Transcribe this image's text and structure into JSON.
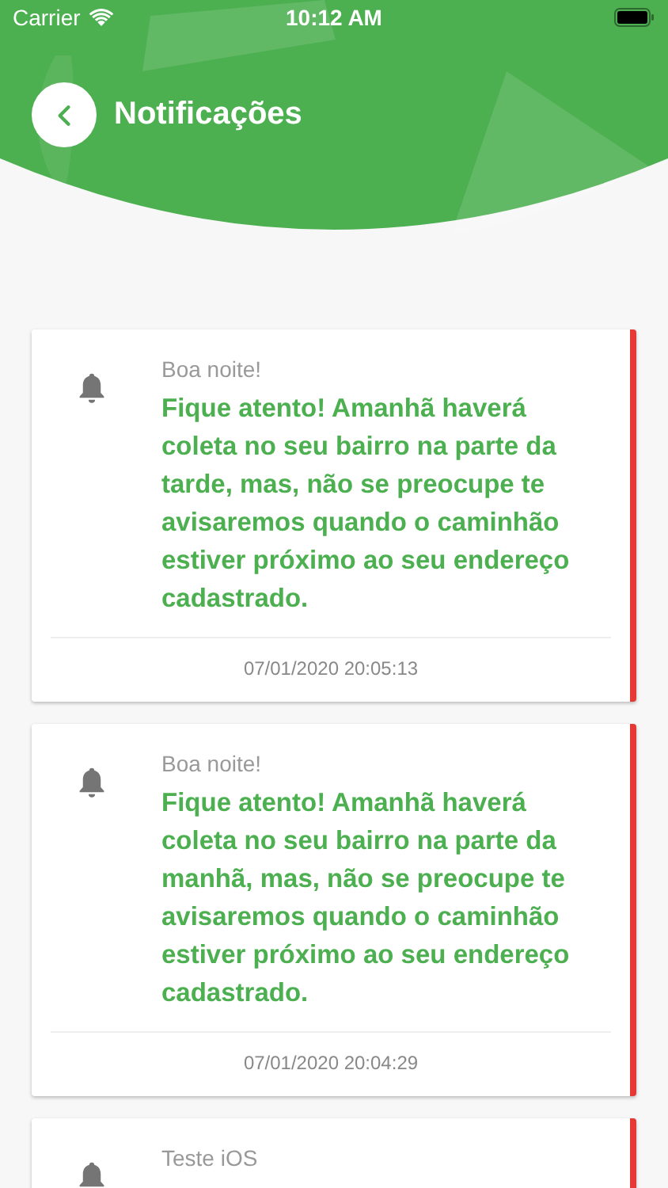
{
  "status_bar": {
    "carrier": "Carrier",
    "time": "10:12 AM"
  },
  "header": {
    "title": "Notificações"
  },
  "notifications": [
    {
      "title": "Boa noite!",
      "message": "Fique atento! Amanhã haverá coleta no seu bairro na parte da tarde, mas, não se preocupe te avisaremos quando o caminhão estiver próximo ao seu endereço cadastrado.",
      "date": "07/01/2020 20:05:13"
    },
    {
      "title": "Boa noite!",
      "message": "Fique atento! Amanhã haverá coleta no seu bairro na parte da manhã, mas, não se preocupe te avisaremos quando o caminhão estiver próximo ao seu endereço cadastrado.",
      "date": "07/01/2020 20:04:29"
    },
    {
      "title": "Teste iOS"
    }
  ]
}
